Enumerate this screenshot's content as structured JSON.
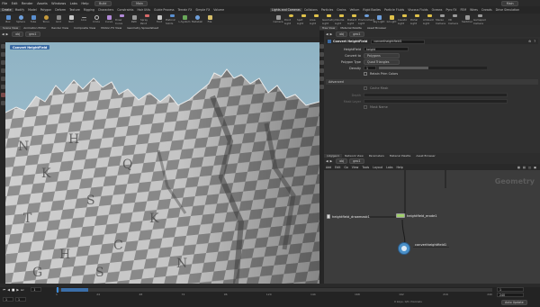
{
  "menu": [
    "File",
    "Edit",
    "Render",
    "Assets",
    "Windows",
    "Labs",
    "Help"
  ],
  "desktop": "Build",
  "scene_dropdown": "Main",
  "search_placeholder": "",
  "shelf_tabs": [
    "Create",
    "Modify",
    "Model",
    "Polygon",
    "Deform",
    "Texture",
    "Rigging",
    "Characters",
    "Constraints",
    "Hair Utils",
    "Guide Process",
    "Terrain FX",
    "Simple FX",
    "Volume"
  ],
  "shelf_tabs_right": [
    "Lights and Cameras",
    "Collisions",
    "Particles",
    "Grains",
    "Vellum",
    "Rigid Bodies",
    "Particle Fluids",
    "Viscous Fluids",
    "Oceans",
    "Pyro FX",
    "FEM",
    "Wires",
    "Crowds",
    "Drive Simulation"
  ],
  "tools": [
    "Box",
    "Sphere",
    "Tube",
    "Torus",
    "Grid",
    "Null",
    "Line",
    "Circle",
    "Curve",
    "Draw Curve",
    "Path",
    "Spray Paint",
    "Font",
    "Platonic Solids",
    "L-System",
    "Metaball",
    "File"
  ],
  "tools_right": [
    "Camera",
    "Point Light",
    "Spot Light",
    "Area Light",
    "Geometry Light",
    "Volume Light",
    "Distant Light",
    "Environment Light",
    "Sky Light",
    "GI Light",
    "Caustic Light",
    "Portal Light",
    "Ambient Light",
    "Stereo Camera",
    "VR Camera",
    "Switcher",
    "Gamepad Camera"
  ],
  "context_bar": {
    "left": "obj",
    "node": "geo1"
  },
  "left_tabs": [
    "Scene View",
    "Animation Editor",
    "Render View",
    "Composite View",
    "Motion FX View",
    "Geometry Spreadsheet"
  ],
  "right_tabs": [
    "Tree View",
    "Material Palette",
    "Asset Browser"
  ],
  "viewport_label": "Convert HeightField",
  "param_panel": {
    "node_type": "Convert HeightField",
    "node_name": "convertheightfield1",
    "rows": [
      {
        "label": "HeightField",
        "value": "height"
      },
      {
        "label": "Convert to",
        "value": "Polygons"
      },
      {
        "label": "Polygon Type",
        "value": "Quad Triangles"
      },
      {
        "label": "Density",
        "value": "1"
      }
    ],
    "checkbox_label": "Retain Prim Colors",
    "section": "Advanced",
    "section_rows": [
      "Cache Mask",
      "Depth",
      "Mask Layer",
      "Mask Name"
    ]
  },
  "network": {
    "tabs": [
      "/obj/geo1",
      "Network View",
      "Parameters",
      "Material Palette",
      "Asset Browser"
    ],
    "menu": [
      "Add",
      "Edit",
      "Go",
      "View",
      "Tools",
      "Layout",
      "Labs",
      "Help"
    ],
    "watermark": "Geometry",
    "nodes": [
      {
        "name": "heightfield_erode1"
      },
      {
        "name": "heightfield_drawmask1"
      },
      {
        "name": "convertheightfield1"
      }
    ]
  },
  "timeline": {
    "frame": "1",
    "start": "1",
    "end": "240",
    "ticks": [
      "24",
      "48",
      "72",
      "96",
      "120",
      "144",
      "168",
      "192",
      "216",
      "240"
    ],
    "right_fields": [
      "1",
      "240"
    ],
    "keys_label": "0 keys, 0/0 channels",
    "auto_update": "Auto Update"
  },
  "colors": {
    "accent": "#3a6aa3",
    "selected_node": "#f2e94e"
  }
}
